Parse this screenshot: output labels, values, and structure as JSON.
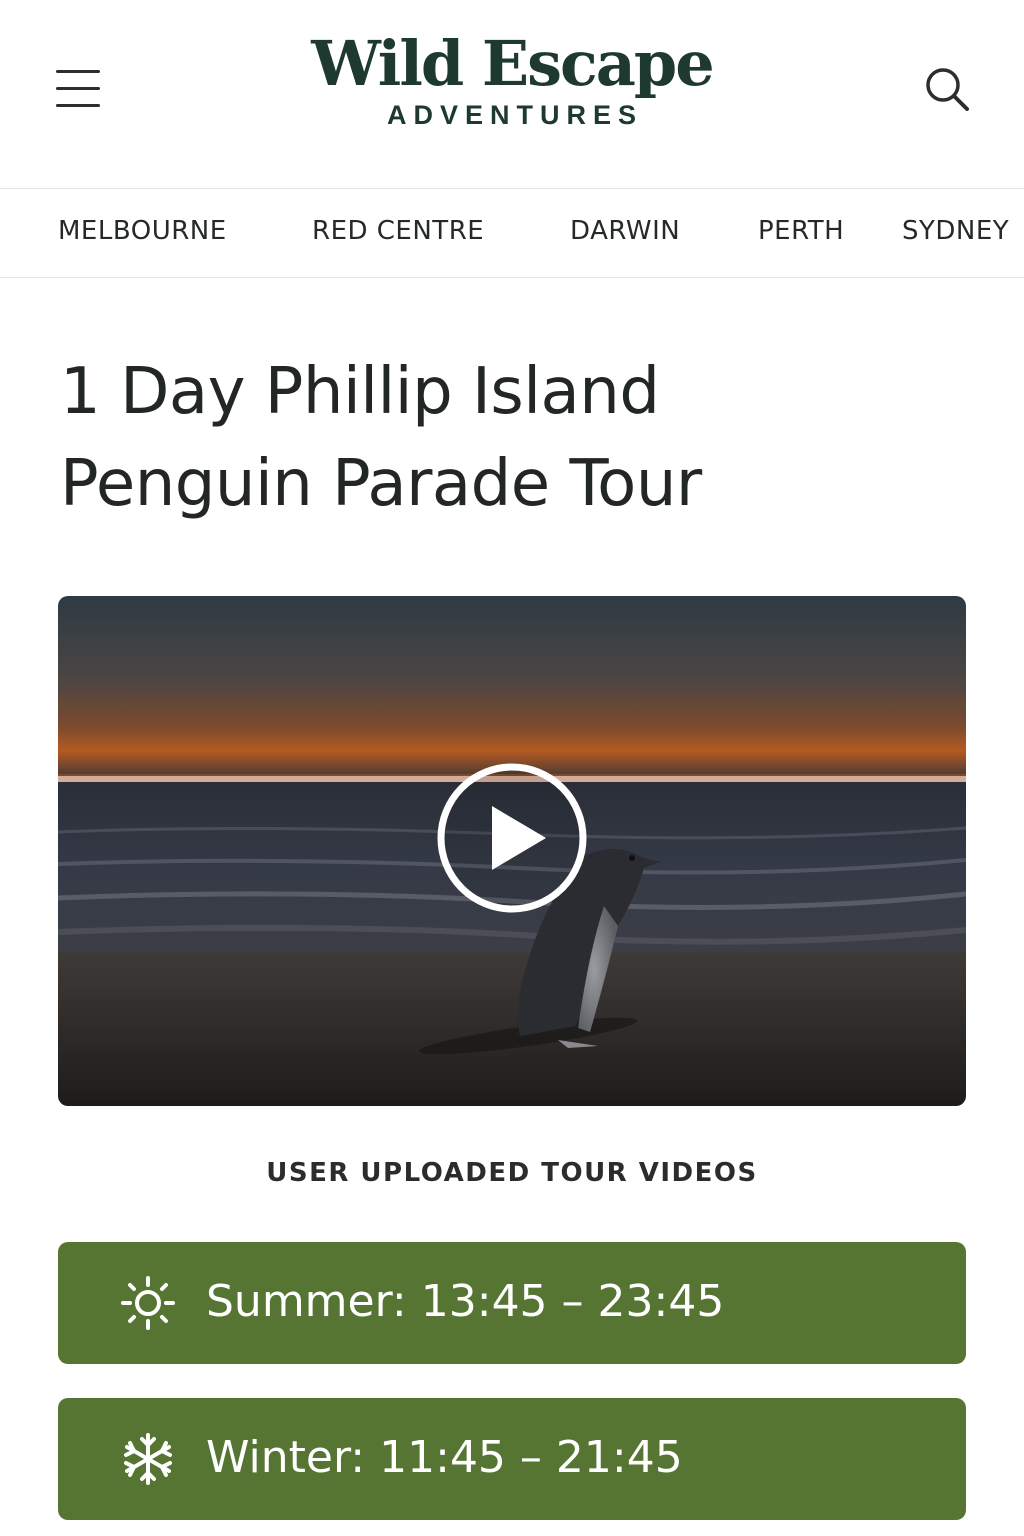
{
  "brand": {
    "name": "Wild Escape",
    "tagline": "ADVENTURES",
    "color": "#1e3a30"
  },
  "header": {
    "menu_icon": "hamburger-menu-icon",
    "search_icon": "search-icon"
  },
  "nav": {
    "items": [
      "MELBOURNE",
      "RED CENTRE",
      "DARWIN",
      "PERTH",
      "SYDNEY"
    ]
  },
  "tour": {
    "title_line1": "1 Day Phillip Island",
    "title_line2": "Penguin Parade Tour"
  },
  "video": {
    "play_icon": "play-icon",
    "caption": "USER UPLOADED TOUR VIDEOS"
  },
  "seasons": [
    {
      "icon": "sun-icon",
      "label": "Summer:",
      "time": "13:45 – 23:45"
    },
    {
      "icon": "snowflake-icon",
      "label": "Winter:",
      "time": "11:45 – 21:45"
    }
  ],
  "colors": {
    "season_bar": "#567533",
    "text_dark": "#222624"
  }
}
